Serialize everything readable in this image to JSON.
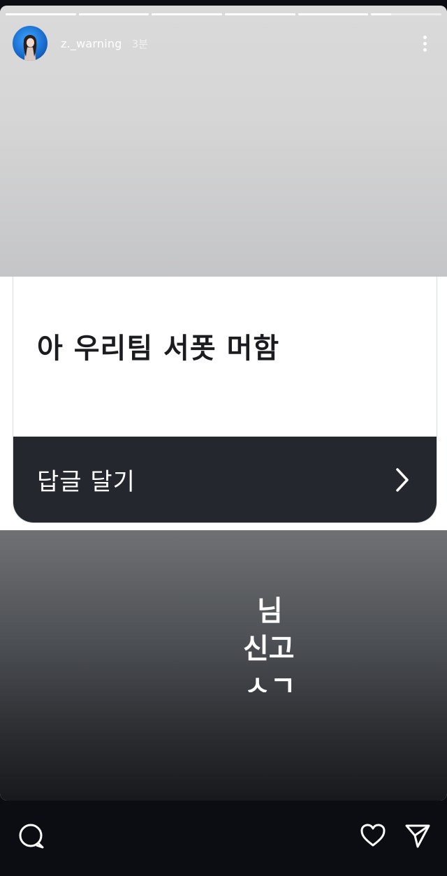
{
  "story": {
    "username": "z._warning",
    "time": "3분",
    "progress_segments": [
      1,
      1,
      1,
      1,
      1,
      0.28
    ]
  },
  "question_card": {
    "question": "아 우리팀 서폿 머함",
    "reply_label": "답글 달기"
  },
  "message_lines": [
    "님",
    "신고",
    "ㅅㄱ"
  ],
  "bottom_bar": {
    "icons": [
      "comment-icon",
      "heart-icon",
      "send-icon"
    ]
  },
  "colors": {
    "reply_bar": "#24272d",
    "background": "#0b0d12"
  }
}
